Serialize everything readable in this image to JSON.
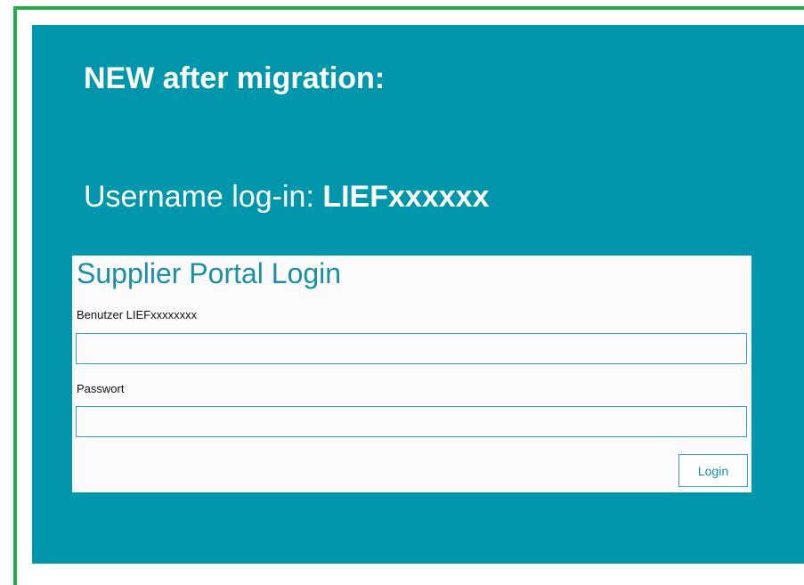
{
  "slide": {
    "headline": "NEW after migration:",
    "username_prefix": "Username log-in: ",
    "username_value": "LIEFxxxxxx"
  },
  "login_form": {
    "title": "Supplier Portal Login",
    "username_label": "Benutzer LIEFxxxxxxxx",
    "username_value": "",
    "password_label": "Passwort",
    "password_value": "",
    "submit_label": "Login"
  },
  "colors": {
    "panel_background": "#0097ac",
    "frame_border": "#1fae4b",
    "accent_text": "#1a8fa6",
    "input_border": "#3a9fb3",
    "card_background": "#fbfbfb"
  }
}
